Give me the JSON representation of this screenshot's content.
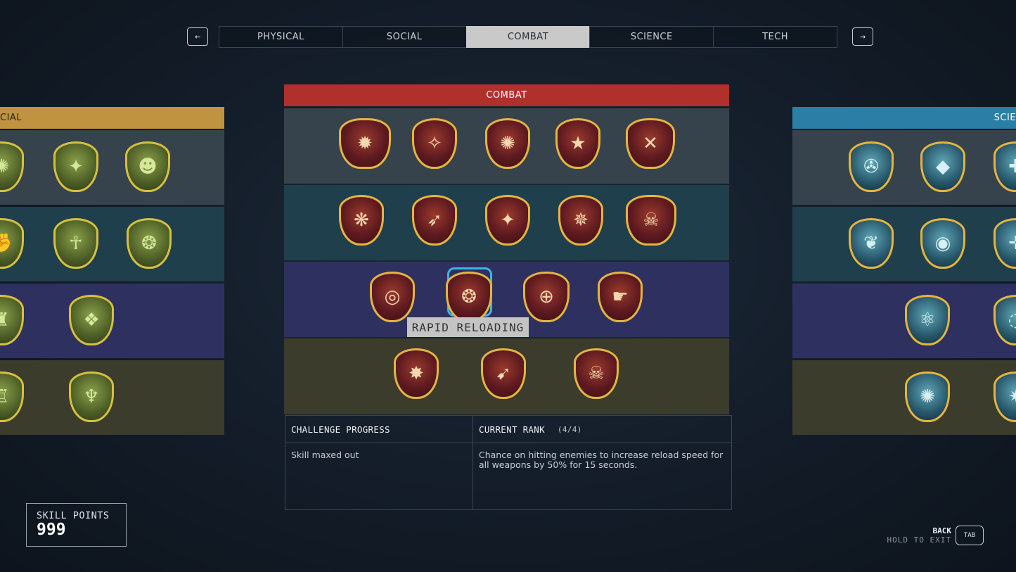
{
  "nav": {
    "prev_arrow": "←",
    "next_arrow": "→",
    "tabs": [
      "PHYSICAL",
      "SOCIAL",
      "COMBAT",
      "SCIENCE",
      "TECH"
    ],
    "active_tab": "COMBAT"
  },
  "panels": {
    "left_title": "CIAL",
    "center_title": "COMBAT",
    "right_title": "SCIE",
    "colors": {
      "social": "#c09340",
      "combat": "#b0302c",
      "science": "#2b7fa6"
    }
  },
  "combat_rows": [
    {
      "count": 5
    },
    {
      "count": 5
    },
    {
      "count": 4
    },
    {
      "count": 3
    }
  ],
  "selected_skill": {
    "name": "RAPID RELOADING"
  },
  "info": {
    "challenge_label": "CHALLENGE PROGRESS",
    "challenge_text": "Skill maxed out",
    "rank_label": "CURRENT RANK",
    "rank_value": "(4/4)",
    "description": "Chance on hitting enemies to increase reload speed for all weapons by 50% for 15 seconds."
  },
  "skill_points": {
    "label": "SKILL POINTS",
    "value": "999"
  },
  "back": {
    "label": "BACK",
    "hold": "HOLD TO EXIT",
    "key": "TAB"
  }
}
